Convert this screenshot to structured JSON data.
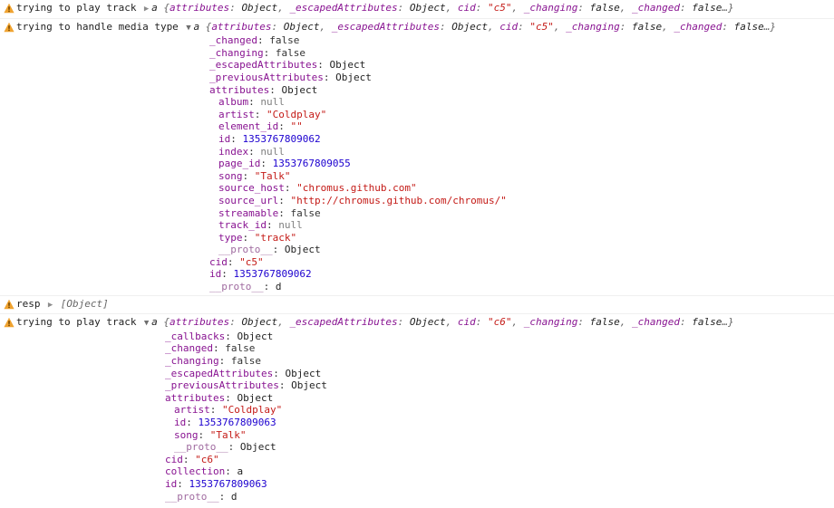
{
  "console": {
    "icon": "warning-triangle-icon",
    "colors": {
      "key": "#881391",
      "string": "#c41a16",
      "number": "#1c00cf",
      "boolean": "#333333",
      "null": "#7f7f7f",
      "proto_key": "#a06ba0",
      "warning_icon": "#f0a330",
      "separator": "#f0f0f0"
    },
    "entries": [
      {
        "id": "entry-1",
        "message": "trying to play track",
        "arrow": "▶",
        "expanded": false,
        "ctor": "a",
        "preview": {
          "open": "{",
          "close": "…}",
          "pairs": [
            {
              "key": "attributes",
              "value": "Object",
              "type": "obj"
            },
            {
              "key": "_escapedAttributes",
              "value": "Object",
              "type": "obj"
            },
            {
              "key": "cid",
              "value": "\"c5\"",
              "type": "str"
            },
            {
              "key": "_changing",
              "value": "false",
              "type": "bool"
            },
            {
              "key": "_changed",
              "value": "false",
              "type": "bool"
            }
          ]
        },
        "tree": []
      },
      {
        "id": "entry-2",
        "message": "trying to handle media type",
        "arrow": "▼",
        "expanded": true,
        "ctor": "a",
        "preview": {
          "open": "{",
          "close": "…}",
          "pairs": [
            {
              "key": "attributes",
              "value": "Object",
              "type": "obj"
            },
            {
              "key": "_escapedAttributes",
              "value": "Object",
              "type": "obj"
            },
            {
              "key": "cid",
              "value": "\"c5\"",
              "type": "str"
            },
            {
              "key": "_changing",
              "value": "false",
              "type": "bool"
            },
            {
              "key": "_changed",
              "value": "false",
              "type": "bool"
            }
          ]
        },
        "tree": [
          {
            "indent": 0,
            "arrow": "",
            "key": "_changed",
            "value": "false",
            "type": "bool"
          },
          {
            "indent": 0,
            "arrow": "",
            "key": "_changing",
            "value": "false",
            "type": "bool"
          },
          {
            "indent": 0,
            "arrow": "▶",
            "key": "_escapedAttributes",
            "value": "Object",
            "type": "obj"
          },
          {
            "indent": 0,
            "arrow": "▶",
            "key": "_previousAttributes",
            "value": "Object",
            "type": "obj"
          },
          {
            "indent": 0,
            "arrow": "▼",
            "key": "attributes",
            "value": "Object",
            "type": "obj"
          },
          {
            "indent": 1,
            "arrow": "",
            "key": "album",
            "value": "null",
            "type": "null"
          },
          {
            "indent": 1,
            "arrow": "",
            "key": "artist",
            "value": "\"Coldplay\"",
            "type": "str"
          },
          {
            "indent": 1,
            "arrow": "",
            "key": "element_id",
            "value": "\"\"",
            "type": "str"
          },
          {
            "indent": 1,
            "arrow": "",
            "key": "id",
            "value": "1353767809062",
            "type": "num"
          },
          {
            "indent": 1,
            "arrow": "",
            "key": "index",
            "value": "null",
            "type": "null"
          },
          {
            "indent": 1,
            "arrow": "",
            "key": "page_id",
            "value": "1353767809055",
            "type": "num"
          },
          {
            "indent": 1,
            "arrow": "",
            "key": "song",
            "value": "\"Talk\"",
            "type": "str"
          },
          {
            "indent": 1,
            "arrow": "",
            "key": "source_host",
            "value": "\"chromus.github.com\"",
            "type": "str"
          },
          {
            "indent": 1,
            "arrow": "",
            "key": "source_url",
            "value": "\"http://chromus.github.com/chromus/\"",
            "type": "str"
          },
          {
            "indent": 1,
            "arrow": "",
            "key": "streamable",
            "value": "false",
            "type": "bool"
          },
          {
            "indent": 1,
            "arrow": "",
            "key": "track_id",
            "value": "null",
            "type": "null"
          },
          {
            "indent": 1,
            "arrow": "",
            "key": "type",
            "value": "\"track\"",
            "type": "str"
          },
          {
            "indent": 1,
            "arrow": "▶",
            "key": "__proto__",
            "value": "Object",
            "type": "obj",
            "proto": true
          },
          {
            "indent": 0,
            "arrow": "",
            "key": "cid",
            "value": "\"c5\"",
            "type": "str"
          },
          {
            "indent": 0,
            "arrow": "",
            "key": "id",
            "value": "1353767809062",
            "type": "num"
          },
          {
            "indent": 0,
            "arrow": "▶",
            "key": "__proto__",
            "value": "d",
            "type": "ctor",
            "proto": true
          }
        ]
      },
      {
        "id": "entry-3",
        "message": "resp",
        "arrow": "▶",
        "expanded": false,
        "ctor": "",
        "preview": {
          "open": "",
          "close": "",
          "array_label": "[Object]",
          "pairs": []
        },
        "tree": []
      },
      {
        "id": "entry-4",
        "message": "trying to play track",
        "arrow": "▼",
        "expanded": true,
        "ctor": "a",
        "preview": {
          "open": "{",
          "close": "…}",
          "pairs": [
            {
              "key": "attributes",
              "value": "Object",
              "type": "obj"
            },
            {
              "key": "_escapedAttributes",
              "value": "Object",
              "type": "obj"
            },
            {
              "key": "cid",
              "value": "\"c6\"",
              "type": "str"
            },
            {
              "key": "_changing",
              "value": "false",
              "type": "bool"
            },
            {
              "key": "_changed",
              "value": "false",
              "type": "bool"
            }
          ]
        },
        "tree": [
          {
            "indent": 0,
            "arrow": "▶",
            "key": "_callbacks",
            "value": "Object",
            "type": "obj"
          },
          {
            "indent": 0,
            "arrow": "",
            "key": "_changed",
            "value": "false",
            "type": "bool"
          },
          {
            "indent": 0,
            "arrow": "",
            "key": "_changing",
            "value": "false",
            "type": "bool"
          },
          {
            "indent": 0,
            "arrow": "▶",
            "key": "_escapedAttributes",
            "value": "Object",
            "type": "obj"
          },
          {
            "indent": 0,
            "arrow": "▶",
            "key": "_previousAttributes",
            "value": "Object",
            "type": "obj"
          },
          {
            "indent": 0,
            "arrow": "▼",
            "key": "attributes",
            "value": "Object",
            "type": "obj"
          },
          {
            "indent": 1,
            "arrow": "",
            "key": "artist",
            "value": "\"Coldplay\"",
            "type": "str"
          },
          {
            "indent": 1,
            "arrow": "",
            "key": "id",
            "value": "1353767809063",
            "type": "num"
          },
          {
            "indent": 1,
            "arrow": "",
            "key": "song",
            "value": "\"Talk\"",
            "type": "str"
          },
          {
            "indent": 1,
            "arrow": "▶",
            "key": "__proto__",
            "value": "Object",
            "type": "obj",
            "proto": true
          },
          {
            "indent": 0,
            "arrow": "",
            "key": "cid",
            "value": "\"c6\"",
            "type": "str"
          },
          {
            "indent": 0,
            "arrow": "▶",
            "key": "collection",
            "value": "a",
            "type": "ctor"
          },
          {
            "indent": 0,
            "arrow": "",
            "key": "id",
            "value": "1353767809063",
            "type": "num"
          },
          {
            "indent": 0,
            "arrow": "▶",
            "key": "__proto__",
            "value": "d",
            "type": "ctor",
            "proto": true
          }
        ]
      }
    ]
  }
}
